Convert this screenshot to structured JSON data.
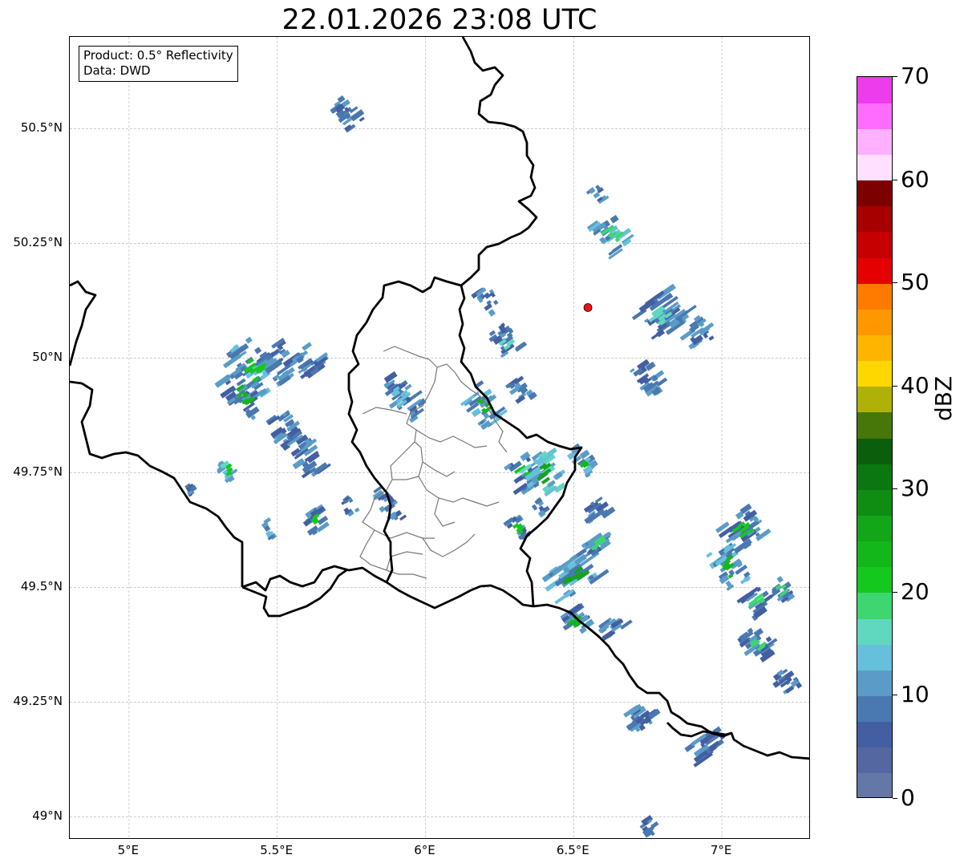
{
  "title": "22.01.2026 23:08 UTC",
  "info": {
    "product": "Product: 0.5° Reflectivity",
    "source": "Data: DWD"
  },
  "map": {
    "lon_range": [
      4.8,
      7.3
    ],
    "lat_range": [
      48.95,
      50.7
    ],
    "lon_ticks": [
      {
        "value": 5.0,
        "label": "5°E"
      },
      {
        "value": 5.5,
        "label": "5.5°E"
      },
      {
        "value": 6.0,
        "label": "6°E"
      },
      {
        "value": 6.5,
        "label": "6.5°E"
      },
      {
        "value": 7.0,
        "label": "7°E"
      }
    ],
    "lat_ticks": [
      {
        "value": 50.5,
        "label": "50.5°N"
      },
      {
        "value": 50.25,
        "label": "50.25°N"
      },
      {
        "value": 50.0,
        "label": "50°N"
      },
      {
        "value": 49.75,
        "label": "49.75°N"
      },
      {
        "value": 49.5,
        "label": "49.5°N"
      },
      {
        "value": 49.25,
        "label": "49.25°N"
      },
      {
        "value": 49.0,
        "label": "49°N"
      }
    ],
    "radar_site": {
      "lon": 6.548,
      "lat": 50.11,
      "color": "#ee1111"
    },
    "border_color": "#000000",
    "district_color": "#777777"
  },
  "colorbar": {
    "label": "dBZ",
    "min": 0,
    "max": 70,
    "step": 2.5,
    "ticks": [
      {
        "value": 0,
        "label": "0"
      },
      {
        "value": 10,
        "label": "10"
      },
      {
        "value": 20,
        "label": "20"
      },
      {
        "value": 30,
        "label": "30"
      },
      {
        "value": 40,
        "label": "40"
      },
      {
        "value": 50,
        "label": "50"
      },
      {
        "value": 60,
        "label": "60"
      },
      {
        "value": 70,
        "label": "70"
      }
    ],
    "colors": [
      "#6577a7",
      "#5467a1",
      "#435fa2",
      "#4a78b0",
      "#5a9cc7",
      "#66c0dc",
      "#60d8c0",
      "#3dd670",
      "#14c81e",
      "#13b71a",
      "#12a618",
      "#0f8c12",
      "#0b7710",
      "#0a5e0c",
      "#477708",
      "#afb108",
      "#ffd700",
      "#ffb400",
      "#ff9800",
      "#ff7b00",
      "#e50000",
      "#c60000",
      "#a60000",
      "#7d0000",
      "#ffe0ff",
      "#ffb0ff",
      "#ff6cff",
      "#ec3cec"
    ]
  },
  "echoes": [
    {
      "lon": 5.73,
      "lat": 50.54,
      "rlon": 0.04,
      "rlat": 0.04,
      "level": 3
    },
    {
      "lon": 5.42,
      "lat": 49.98,
      "rlon": 0.07,
      "rlat": 0.07,
      "level": 4,
      "core": 8
    },
    {
      "lon": 5.38,
      "lat": 49.92,
      "rlon": 0.05,
      "rlat": 0.06,
      "level": 3,
      "core": 9
    },
    {
      "lon": 5.52,
      "lat": 50.0,
      "rlon": 0.07,
      "rlat": 0.05,
      "level": 3
    },
    {
      "lon": 5.61,
      "lat": 50.0,
      "rlon": 0.05,
      "rlat": 0.04,
      "level": 3
    },
    {
      "lon": 5.58,
      "lat": 49.8,
      "rlon": 0.05,
      "rlat": 0.07,
      "level": 3
    },
    {
      "lon": 5.52,
      "lat": 49.85,
      "rlon": 0.04,
      "rlat": 0.05,
      "level": 3
    },
    {
      "lon": 5.33,
      "lat": 49.76,
      "rlon": 0.025,
      "rlat": 0.025,
      "level": 5,
      "core": 8
    },
    {
      "lon": 5.2,
      "lat": 49.72,
      "rlon": 0.015,
      "rlat": 0.02,
      "level": 3
    },
    {
      "lon": 5.63,
      "lat": 49.65,
      "rlon": 0.04,
      "rlat": 0.025,
      "level": 3,
      "core": 8
    },
    {
      "lon": 5.74,
      "lat": 49.68,
      "rlon": 0.02,
      "rlat": 0.02,
      "level": 3
    },
    {
      "lon": 5.47,
      "lat": 49.63,
      "rlon": 0.015,
      "rlat": 0.02,
      "level": 4
    },
    {
      "lon": 5.92,
      "lat": 49.92,
      "rlon": 0.05,
      "rlat": 0.06,
      "level": 3,
      "core": 5
    },
    {
      "lon": 5.87,
      "lat": 49.68,
      "rlon": 0.03,
      "rlat": 0.05,
      "level": 3
    },
    {
      "lon": 6.19,
      "lat": 49.9,
      "rlon": 0.05,
      "rlat": 0.05,
      "level": 4,
      "core": 9
    },
    {
      "lon": 6.27,
      "lat": 50.04,
      "rlon": 0.04,
      "rlat": 0.04,
      "level": 3,
      "core": 6
    },
    {
      "lon": 6.21,
      "lat": 50.13,
      "rlon": 0.03,
      "rlat": 0.03,
      "level": 3
    },
    {
      "lon": 6.32,
      "lat": 49.93,
      "rlon": 0.03,
      "rlat": 0.03,
      "level": 3
    },
    {
      "lon": 6.33,
      "lat": 49.75,
      "rlon": 0.05,
      "rlat": 0.04,
      "level": 3,
      "core": 8
    },
    {
      "lon": 6.4,
      "lat": 49.75,
      "rlon": 0.06,
      "rlat": 0.05,
      "level": 5,
      "core": 10
    },
    {
      "lon": 6.53,
      "lat": 49.78,
      "rlon": 0.03,
      "rlat": 0.04,
      "level": 4,
      "core": 9
    },
    {
      "lon": 6.31,
      "lat": 49.63,
      "rlon": 0.03,
      "rlat": 0.03,
      "level": 3,
      "core": 8
    },
    {
      "lon": 6.5,
      "lat": 49.53,
      "rlon": 0.09,
      "rlat": 0.04,
      "level": 4,
      "core": 10
    },
    {
      "lon": 6.58,
      "lat": 49.6,
      "rlon": 0.06,
      "rlat": 0.02,
      "level": 3,
      "core": 7
    },
    {
      "lon": 6.5,
      "lat": 49.43,
      "rlon": 0.05,
      "rlat": 0.03,
      "level": 3,
      "core": 9
    },
    {
      "lon": 6.63,
      "lat": 49.42,
      "rlon": 0.05,
      "rlat": 0.02,
      "level": 3
    },
    {
      "lon": 6.63,
      "lat": 50.27,
      "rlon": 0.05,
      "rlat": 0.05,
      "level": 4,
      "core": 7
    },
    {
      "lon": 6.8,
      "lat": 50.1,
      "rlon": 0.09,
      "rlat": 0.05,
      "level": 3,
      "core": 6
    },
    {
      "lon": 6.92,
      "lat": 50.06,
      "rlon": 0.05,
      "rlat": 0.03,
      "level": 3
    },
    {
      "lon": 6.58,
      "lat": 50.36,
      "rlon": 0.02,
      "rlat": 0.02,
      "level": 3
    },
    {
      "lon": 6.75,
      "lat": 49.96,
      "rlon": 0.04,
      "rlat": 0.04,
      "level": 3
    },
    {
      "lon": 6.57,
      "lat": 49.67,
      "rlon": 0.05,
      "rlat": 0.02,
      "level": 3
    },
    {
      "lon": 7.02,
      "lat": 49.55,
      "rlon": 0.05,
      "rlat": 0.06,
      "level": 4,
      "core": 9
    },
    {
      "lon": 7.07,
      "lat": 49.63,
      "rlon": 0.07,
      "rlat": 0.04,
      "level": 3,
      "core": 8
    },
    {
      "lon": 7.12,
      "lat": 49.47,
      "rlon": 0.05,
      "rlat": 0.03,
      "level": 3,
      "core": 7
    },
    {
      "lon": 7.2,
      "lat": 49.5,
      "rlon": 0.03,
      "rlat": 0.03,
      "level": 3,
      "core": 7
    },
    {
      "lon": 7.12,
      "lat": 49.38,
      "rlon": 0.05,
      "rlat": 0.04,
      "level": 3,
      "core": 7
    },
    {
      "lon": 7.21,
      "lat": 49.3,
      "rlon": 0.04,
      "rlat": 0.03,
      "level": 3
    },
    {
      "lon": 6.73,
      "lat": 49.22,
      "rlon": 0.06,
      "rlat": 0.03,
      "level": 3
    },
    {
      "lon": 6.95,
      "lat": 49.16,
      "rlon": 0.07,
      "rlat": 0.025,
      "level": 3
    },
    {
      "lon": 6.75,
      "lat": 48.98,
      "rlon": 0.03,
      "rlat": 0.02,
      "level": 3
    },
    {
      "lon": 6.38,
      "lat": 49.68,
      "rlon": 0.02,
      "rlat": 0.02,
      "level": 3
    }
  ]
}
